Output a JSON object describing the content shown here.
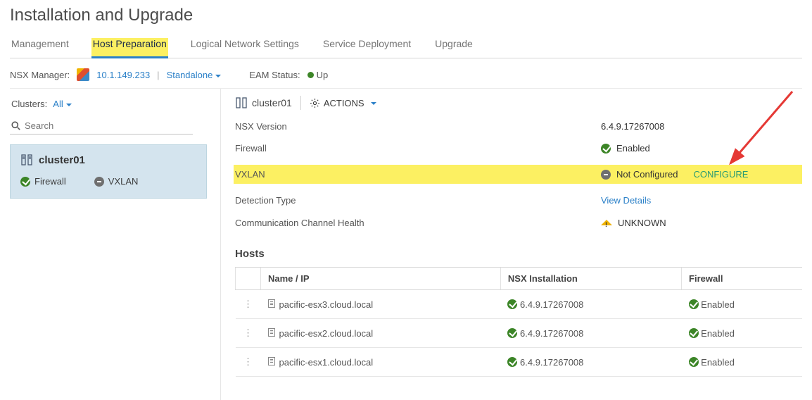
{
  "page_title": "Installation and Upgrade",
  "tabs": {
    "management": "Management",
    "host_prep": "Host Preparation",
    "logical": "Logical Network Settings",
    "service_deploy": "Service Deployment",
    "upgrade": "Upgrade"
  },
  "mgr": {
    "label": "NSX Manager:",
    "ip": "10.1.149.233",
    "mode": "Standalone",
    "eam_label": "EAM Status:",
    "eam_status": "Up"
  },
  "sidebar": {
    "clusters_label": "Clusters:",
    "all_label": "All",
    "search_placeholder": "Search",
    "cluster_name": "cluster01",
    "firewall": "Firewall",
    "vxlan": "VXLAN"
  },
  "details": {
    "cluster_name": "cluster01",
    "actions": "ACTIONS",
    "rows": {
      "version_label": "NSX Version",
      "version_value": "6.4.9.17267008",
      "firewall_label": "Firewall",
      "firewall_value": "Enabled",
      "vxlan_label": "VXLAN",
      "vxlan_value": "Not Configured",
      "vxlan_action": "CONFIGURE",
      "detection_label": "Detection Type",
      "detection_value": "View Details",
      "comm_label": "Communication Channel Health",
      "comm_value": "UNKNOWN"
    }
  },
  "hosts_section": {
    "title": "Hosts",
    "columns": {
      "name": "Name / IP",
      "install": "NSX Installation",
      "firewall": "Firewall"
    },
    "rows": [
      {
        "name": "pacific-esx3.cloud.local",
        "install": "6.4.9.17267008",
        "firewall": "Enabled"
      },
      {
        "name": "pacific-esx2.cloud.local",
        "install": "6.4.9.17267008",
        "firewall": "Enabled"
      },
      {
        "name": "pacific-esx1.cloud.local",
        "install": "6.4.9.17267008",
        "firewall": "Enabled"
      }
    ]
  }
}
